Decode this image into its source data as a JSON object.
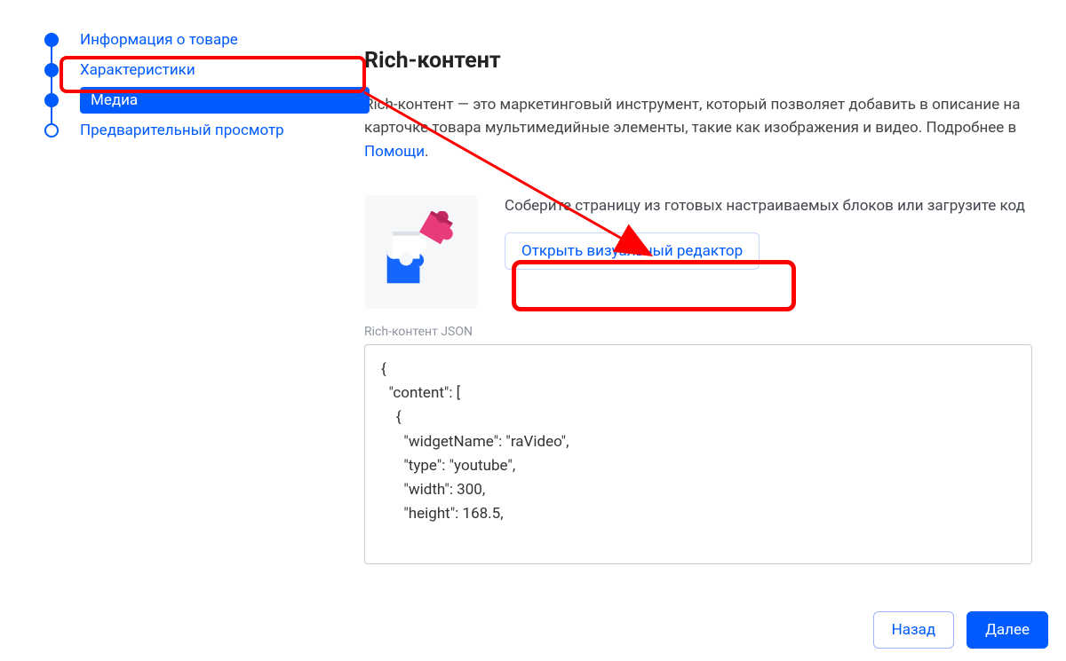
{
  "sidebar": {
    "steps": [
      {
        "label": "Информация о товаре",
        "state": "done"
      },
      {
        "label": "Характеристики",
        "state": "done"
      },
      {
        "label": "Медиа",
        "state": "active"
      },
      {
        "label": "Предварительный просмотр",
        "state": "future"
      }
    ]
  },
  "main": {
    "title": "Rich-контент",
    "desc_before_link": "Rich-контент — это маркетинговый инструмент, который позволяет добавить в описание на карточке товара мультимедийные элементы, такие как изображения и видео. Подробнее в ",
    "link_label": "Помощи",
    "desc_after_link": ".",
    "card_text": "Соберите страницу из готовых настраиваемых блоков или загрузите код",
    "open_editor_button": "Открыть визуальный редактор",
    "json_label": "Rich-контент JSON",
    "json_value": "{\n  \"content\": [\n    {\n      \"widgetName\": \"raVideo\",\n      \"type\": \"youtube\",\n      \"width\": 300,\n      \"height\": 168.5,\n"
  },
  "footer": {
    "back": "Назад",
    "next": "Далее"
  },
  "icons": {
    "puzzle": "puzzle-icon"
  },
  "annotations": {
    "highlight_step_index": 2,
    "highlight_button": true,
    "arrow_from": "sidebar-step-media",
    "arrow_to": "open-editor-button",
    "highlight_color": "#ff0000"
  }
}
